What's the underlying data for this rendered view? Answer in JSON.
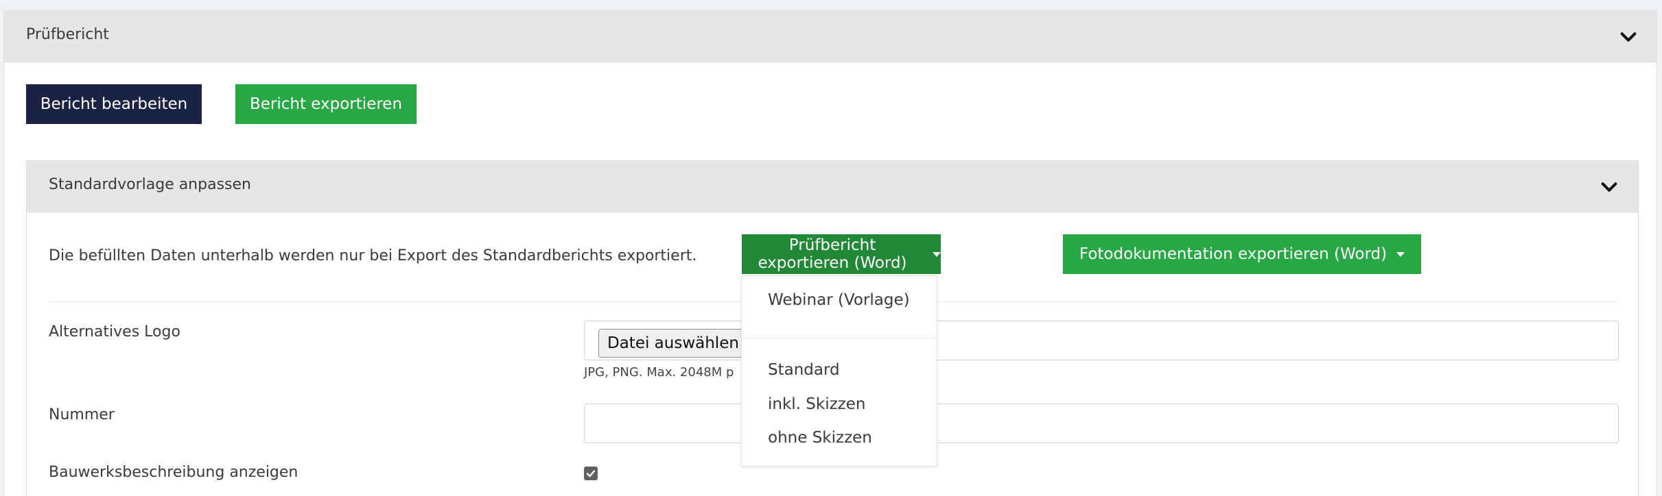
{
  "outer_card": {
    "title": "Prüfbericht",
    "edit_button": "Bericht bearbeiten",
    "export_button": "Bericht exportieren"
  },
  "inner_card": {
    "title": "Standardvorlage anpassen",
    "info": "Die befüllten Daten unterhalb werden nur bei Export des Standardberichts exportiert.",
    "export_word_button": "Prüfbericht exportieren (Word)",
    "photo_export_button": "Fotodokumentation exportieren (Word)"
  },
  "form": {
    "logo_label": "Alternatives Logo",
    "file_button": "Datei auswählen",
    "help_text": "JPG, PNG. Max. 2048M p",
    "number_label": "Nummer",
    "number_value": "",
    "building_label": "Bauwerksbeschreibung anzeigen",
    "building_checked": true
  },
  "dropdown": {
    "items": [
      "Webinar (Vorlage)",
      "Standard",
      "inkl. Skizzen",
      "ohne Skizzen"
    ]
  },
  "colors": {
    "dark_button": "#1b2445",
    "green_button": "#28a745",
    "green_button_active": "#218838",
    "header_bg": "#e6e6e6"
  }
}
